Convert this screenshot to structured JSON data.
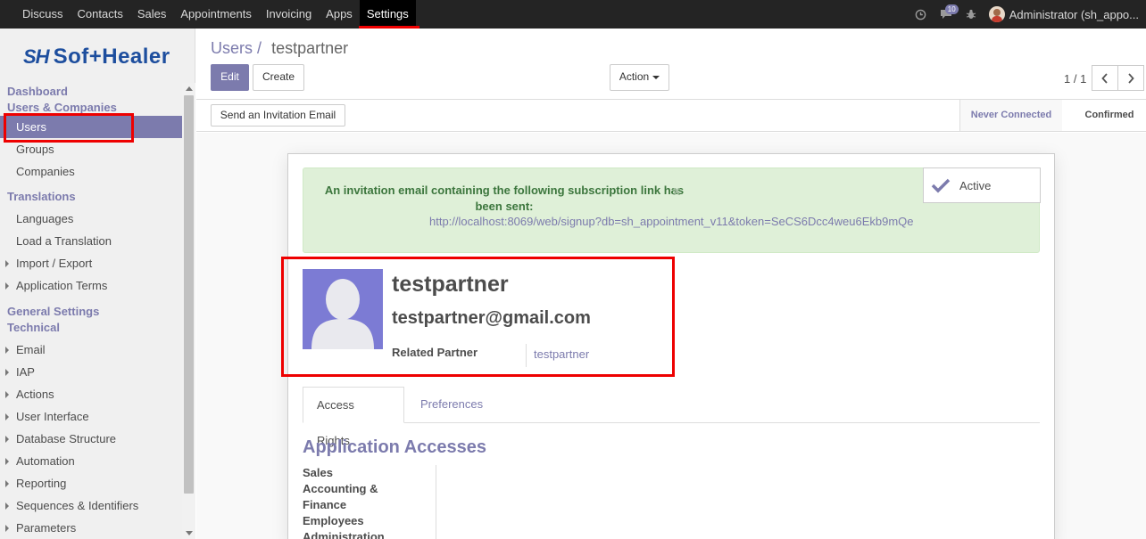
{
  "topbar": {
    "menu": [
      "Discuss",
      "Contacts",
      "Sales",
      "Appointments",
      "Invoicing",
      "Apps",
      "Settings"
    ],
    "active": "Settings",
    "messages_count": "10",
    "user_label": "Administrator (sh_appo..."
  },
  "sidebar": {
    "logo_mark": "SH",
    "logo_word": "Sof+Healer",
    "sections": {
      "dashboard": "Dashboard",
      "users_companies": "Users & Companies",
      "users": "Users",
      "groups": "Groups",
      "companies": "Companies",
      "translations": "Translations",
      "languages": "Languages",
      "load_translation": "Load a Translation",
      "import_export": "Import / Export",
      "application_terms": "Application Terms",
      "general_settings": "General Settings",
      "technical": "Technical",
      "email": "Email",
      "iap": "IAP",
      "actions": "Actions",
      "user_interface": "User Interface",
      "database_structure": "Database Structure",
      "automation": "Automation",
      "reporting": "Reporting",
      "sequences": "Sequences & Identifiers",
      "parameters": "Parameters"
    }
  },
  "control_panel": {
    "breadcrumb_parent": "Users",
    "breadcrumb_sep": "/",
    "breadcrumb_current": "testpartner",
    "edit": "Edit",
    "create": "Create",
    "action": "Action",
    "pager": "1 / 1"
  },
  "statusbar": {
    "invite_button": "Send an Invitation Email",
    "stage_never": "Never Connected",
    "stage_confirmed": "Confirmed"
  },
  "form": {
    "alert_message": "An invitation email containing the following subscription link has been sent:",
    "alert_close": "x",
    "alert_url": "http://localhost:8069/web/signup?db=sh_appointment_v11&token=SeCS6Dcc4weu6Ekb9mQe",
    "active_label": "Active",
    "name": "testpartner",
    "email": "testpartner@gmail.com",
    "related_partner_label": "Related Partner",
    "related_partner_value": "testpartner",
    "tab_access_rights": "Access Rights",
    "tab_preferences": "Preferences",
    "section_title": "Application Accesses",
    "access_items": [
      "Sales",
      "Accounting &",
      "Finance",
      "Employees",
      "Administration"
    ]
  },
  "colors": {
    "accent": "#7c7bad",
    "navbar": "#242424",
    "highlight": "#ee0000",
    "alert_bg": "#dff0d8"
  }
}
